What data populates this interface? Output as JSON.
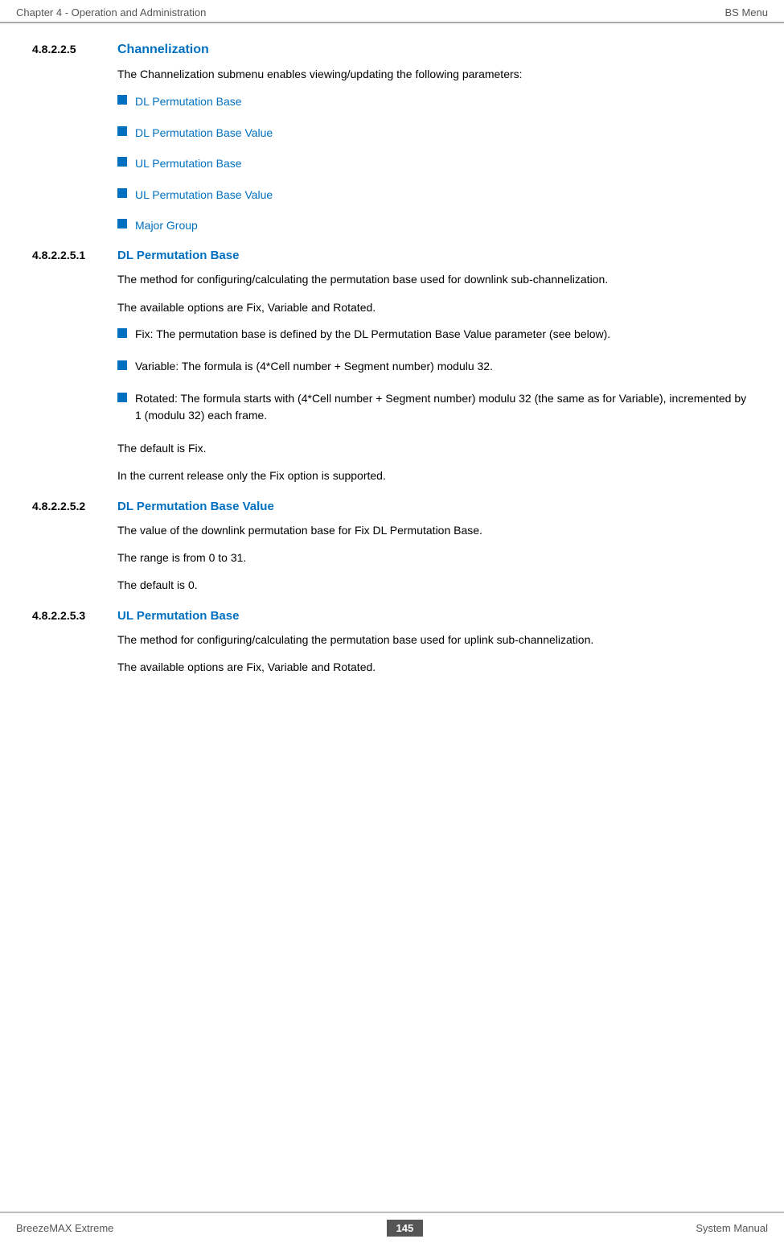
{
  "header": {
    "left": "Chapter 4 - Operation and Administration",
    "right": "BS Menu"
  },
  "footer": {
    "left": "BreezeMAX Extreme",
    "page": "145",
    "right": "System Manual"
  },
  "sections": [
    {
      "number": "4.8.2.2.5",
      "title": "Channelization",
      "intro": "The Channelization submenu enables viewing/updating the following parameters:",
      "bullets": [
        "DL Permutation Base",
        "DL Permutation Base Value",
        "UL Permutation Base",
        "UL Permutation Base Value",
        "Major Group"
      ]
    },
    {
      "number": "4.8.2.2.5.1",
      "title": "DL Permutation Base",
      "paragraphs": [
        "The method for configuring/calculating the permutation base used for downlink sub-channelization.",
        "The available options are Fix, Variable and Rotated."
      ],
      "sub_bullets": [
        {
          "text": "Fix: The permutation base is defined by the DL Permutation Base Value parameter (see below)."
        },
        {
          "text": "Variable: The formula is (4*Cell number + Segment number) modulu 32."
        },
        {
          "text": "Rotated: The formula starts with (4*Cell number + Segment number) modulu 32 (the same as for Variable), incremented by 1 (modulu 32) each frame."
        }
      ],
      "after_bullets": [
        "The default is Fix.",
        "In the current release only the Fix option is supported."
      ]
    },
    {
      "number": "4.8.2.2.5.2",
      "title": "DL Permutation Base Value",
      "paragraphs": [
        "The value of the downlink permutation base for Fix DL Permutation Base.",
        "The range is from 0 to 31.",
        "The default is 0."
      ]
    },
    {
      "number": "4.8.2.2.5.3",
      "title": "UL Permutation Base",
      "paragraphs": [
        "The method for configuring/calculating the permutation base used for uplink sub-channelization.",
        "The available options are Fix, Variable and Rotated."
      ]
    }
  ]
}
